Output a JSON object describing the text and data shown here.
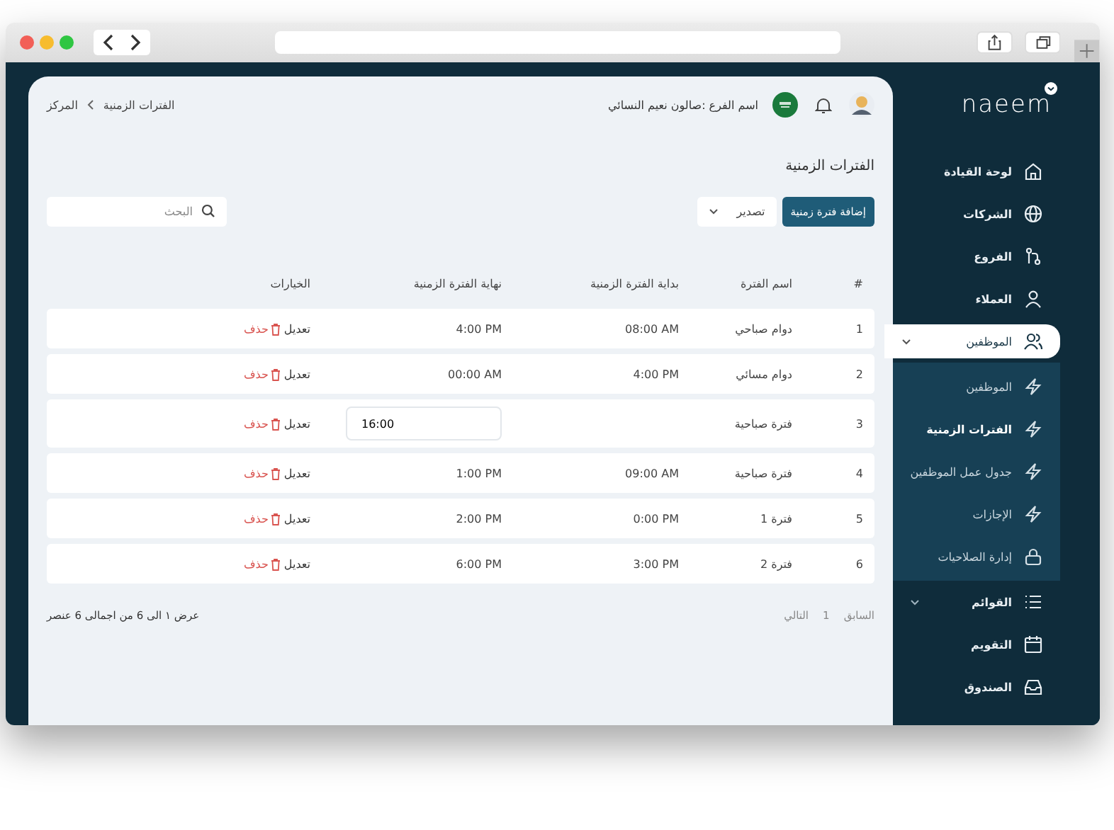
{
  "header": {
    "branch": "اسم الفرع :صالون نعيم النسائي",
    "breadcrumb": [
      "الفترات الزمنية",
      "المركز"
    ]
  },
  "page": {
    "title": "الفترات الزمنية",
    "add_button": "إضافة فترة زمنية",
    "export": "تصدير",
    "search": {
      "placeholder": "البحث"
    }
  },
  "table": {
    "columns": [
      "#",
      "اسم الفترة",
      "بداية الفترة الزمنية",
      "نهاية الفترة الزمنية",
      "الخيارات"
    ],
    "rows": [
      {
        "kind": "view",
        "number": "1",
        "name": "دوام صباحي",
        "start": "08:00 AM",
        "end": "4:00 PM",
        "edit": "تعديل",
        "delete": "حذف"
      },
      {
        "kind": "view",
        "number": "2",
        "name": "دوام مسائي",
        "start": "4:00 PM",
        "end": "00:00 AM",
        "edit": "تعديل",
        "delete": "حذف"
      },
      {
        "kind": "editing",
        "number": "3",
        "name": "فترة صباحية",
        "end": "16:00",
        "edit": "تعديل",
        "delete": "حذف"
      },
      {
        "kind": "view",
        "number": "4",
        "name": "فترة صباحية",
        "start": "09:00 AM",
        "end": "1:00 PM",
        "edit": "تعديل",
        "delete": "حذف"
      },
      {
        "kind": "view",
        "number": "5",
        "name": "فترة 1",
        "start": "0:00 PM",
        "end": "2:00 PM",
        "edit": "تعديل",
        "delete": "حذف"
      },
      {
        "kind": "view",
        "number": "6",
        "name": "فترة 2",
        "start": "3:00 PM",
        "end": "6:00 PM",
        "edit": "تعديل",
        "delete": "حذف"
      }
    ]
  },
  "pagination": {
    "previous": "السابق",
    "page": "1",
    "next": "التالي",
    "summary": "عرض ١ الى 6 من اجمالى 6 عنصر"
  },
  "sidebar": {
    "logo": "naeem",
    "items": [
      {
        "kind": "link",
        "label": "لوحة القيادة",
        "selected": false
      },
      {
        "kind": "link",
        "label": "الشركات",
        "selected": false
      },
      {
        "kind": "link",
        "label": "الفروع",
        "selected": false
      },
      {
        "kind": "link",
        "label": "العملاء",
        "selected": false
      },
      {
        "kind": "group",
        "label": "الموظفين",
        "selected": true,
        "expanded": true,
        "children": [
          {
            "label": "الموظفين",
            "selected": false
          },
          {
            "label": "الفترات الزمنية",
            "selected": true
          },
          {
            "label": "جدول عمل الموظفين",
            "selected": false
          },
          {
            "label": "الإجازات",
            "selected": false
          },
          {
            "label": "إدارة الصلاحيات",
            "selected": false
          }
        ]
      },
      {
        "kind": "group",
        "label": "القوائم",
        "selected": false
      },
      {
        "kind": "link",
        "label": "التقويم",
        "selected": false
      },
      {
        "kind": "link",
        "label": "الصندوق",
        "selected": false
      }
    ]
  }
}
